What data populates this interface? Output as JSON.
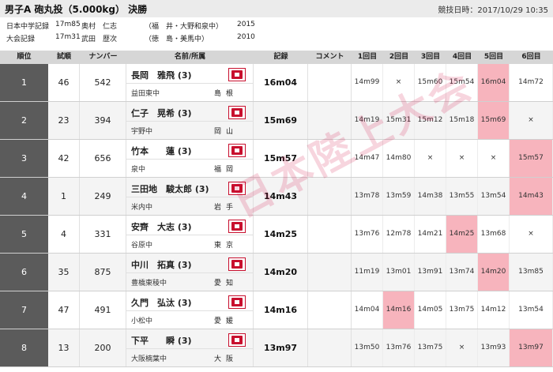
{
  "title": "男子A 砲丸投（5.000kg） 決勝",
  "datetime": "競技日時：2017/10/29 10:35",
  "records": [
    {
      "label": "日本中学記録",
      "mark": "17m85",
      "name": "奥村　仁志",
      "pref": "（福　井・大野和泉中）",
      "year": "2015"
    },
    {
      "label": "大会記録",
      "mark": "17m31",
      "name": "武田　歴次",
      "pref": "（徳　島・美馬中）",
      "year": "2010"
    }
  ],
  "headers": [
    "順位",
    "試順",
    "ナンバー",
    "名前/所属",
    "記録",
    "コメント",
    "1回目",
    "2回目",
    "3回目",
    "4回目",
    "5回目",
    "6回目"
  ],
  "rows": [
    {
      "rank": "1",
      "order": "46",
      "bib": "542",
      "name": "長岡　雅飛 (3)",
      "school": "益田東中",
      "pref": "島根",
      "record": "16m04",
      "attempts": [
        "14m99",
        "×",
        "15m60",
        "15m54",
        "16m04",
        "14m72"
      ],
      "best": 4
    },
    {
      "rank": "2",
      "order": "23",
      "bib": "394",
      "name": "仁子　晃希 (3)",
      "school": "宇野中",
      "pref": "岡山",
      "record": "15m69",
      "attempts": [
        "14m19",
        "15m31",
        "15m12",
        "15m18",
        "15m69",
        "×"
      ],
      "best": 4
    },
    {
      "rank": "3",
      "order": "42",
      "bib": "656",
      "name": "竹本　　蓮 (3)",
      "school": "泉中",
      "pref": "福岡",
      "record": "15m57",
      "attempts": [
        "14m47",
        "14m80",
        "×",
        "×",
        "×",
        "15m57"
      ],
      "best": 5
    },
    {
      "rank": "4",
      "order": "1",
      "bib": "249",
      "name": "三田地　駿太郎 (3)",
      "school": "米内中",
      "pref": "岩手",
      "record": "14m43",
      "attempts": [
        "13m78",
        "13m59",
        "14m38",
        "13m55",
        "13m54",
        "14m43"
      ],
      "best": 5
    },
    {
      "rank": "5",
      "order": "4",
      "bib": "331",
      "name": "安齊　大志 (3)",
      "school": "谷原中",
      "pref": "東京",
      "record": "14m25",
      "attempts": [
        "13m76",
        "12m78",
        "14m21",
        "14m25",
        "13m68",
        "×"
      ],
      "best": 3
    },
    {
      "rank": "6",
      "order": "35",
      "bib": "875",
      "name": "中川　拓真 (3)",
      "school": "豊橋東稜中",
      "pref": "愛知",
      "record": "14m20",
      "attempts": [
        "11m19",
        "13m01",
        "13m91",
        "13m74",
        "14m20",
        "13m85"
      ],
      "best": 4
    },
    {
      "rank": "7",
      "order": "47",
      "bib": "491",
      "name": "久門　弘汰 (3)",
      "school": "小松中",
      "pref": "愛媛",
      "record": "14m16",
      "attempts": [
        "14m04",
        "14m16",
        "14m05",
        "13m75",
        "14m12",
        "13m54"
      ],
      "best": 1
    },
    {
      "rank": "8",
      "order": "13",
      "bib": "200",
      "name": "下平　　瞬 (3)",
      "school": "大阪楠葉中",
      "pref": "大阪",
      "record": "13m97",
      "attempts": [
        "13m50",
        "13m76",
        "13m75",
        "×",
        "13m93",
        "13m97"
      ],
      "best": 5
    }
  ],
  "watermark": "日本陸上大会",
  "colors": {
    "rank_bg": "#5b5b5b",
    "highlight": "#f7b4bd",
    "icon": "#c8102e"
  },
  "icons": {
    "video": "film-icon"
  }
}
